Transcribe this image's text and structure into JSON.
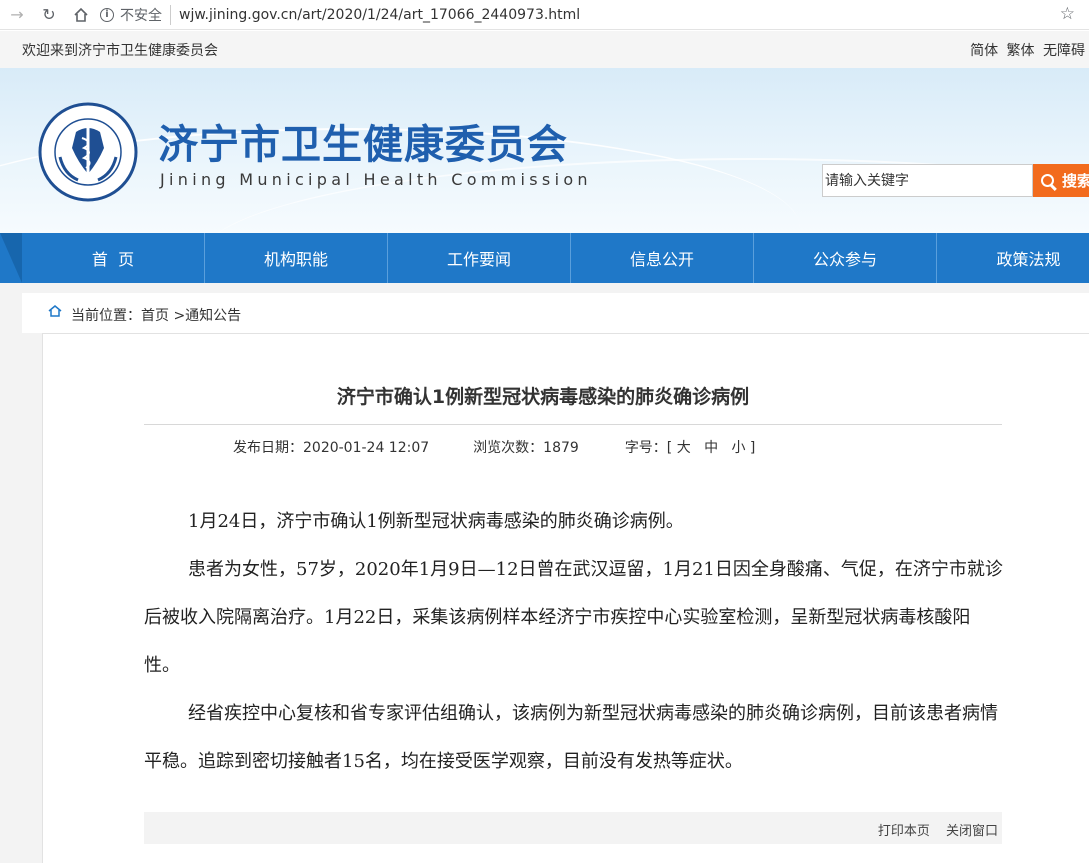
{
  "browser": {
    "security_label": "不安全",
    "url": "wjw.jining.gov.cn/art/2020/1/24/art_17066_2440973.html"
  },
  "topbar": {
    "welcome": "欢迎来到济宁市卫生健康委员会",
    "simplified": "简体",
    "traditional": "繁体",
    "accessibility": "无障碍"
  },
  "header": {
    "org_name_cn": "济宁市卫生健康委员会",
    "org_name_en": "Jining Municipal Health Commission",
    "search_placeholder": "请输入关键字",
    "search_button": "搜索"
  },
  "nav": {
    "items": [
      {
        "label": "首  页"
      },
      {
        "label": "机构职能"
      },
      {
        "label": "工作要闻"
      },
      {
        "label": "信息公开"
      },
      {
        "label": "公众参与"
      },
      {
        "label": "政策法规"
      }
    ]
  },
  "breadcrumb": {
    "prefix": "当前位置：",
    "home": "首页",
    "section": " >通知公告"
  },
  "article": {
    "title": "济宁市确认1例新型冠状病毒感染的肺炎确诊病例",
    "publish_label": "发布日期：",
    "publish_date": "2020-01-24 12:07",
    "views_label": "浏览次数：",
    "views": "1879",
    "fontsize_label": "字号：[ ",
    "size_large": "大",
    "size_medium": "中",
    "size_small": "小",
    "fontsize_end": " ]",
    "paragraphs": [
      "1月24日，济宁市确认1例新型冠状病毒感染的肺炎确诊病例。",
      "患者为女性，57岁，2020年1月9日—12日曾在武汉逗留，1月21日因全身酸痛、气促，在济宁市就诊后被收入院隔离治疗。1月22日，采集该病例样本经济宁市疾控中心实验室检测，呈新型冠状病毒核酸阳性。",
      "经省疾控中心复核和省专家评估组确认，该病例为新型冠状病毒感染的肺炎确诊病例，目前该患者病情平稳。追踪到密切接触者15名，均在接受医学观察，目前没有发热等症状。"
    ],
    "print_label": "打印本页",
    "close_label": "关闭窗口"
  }
}
